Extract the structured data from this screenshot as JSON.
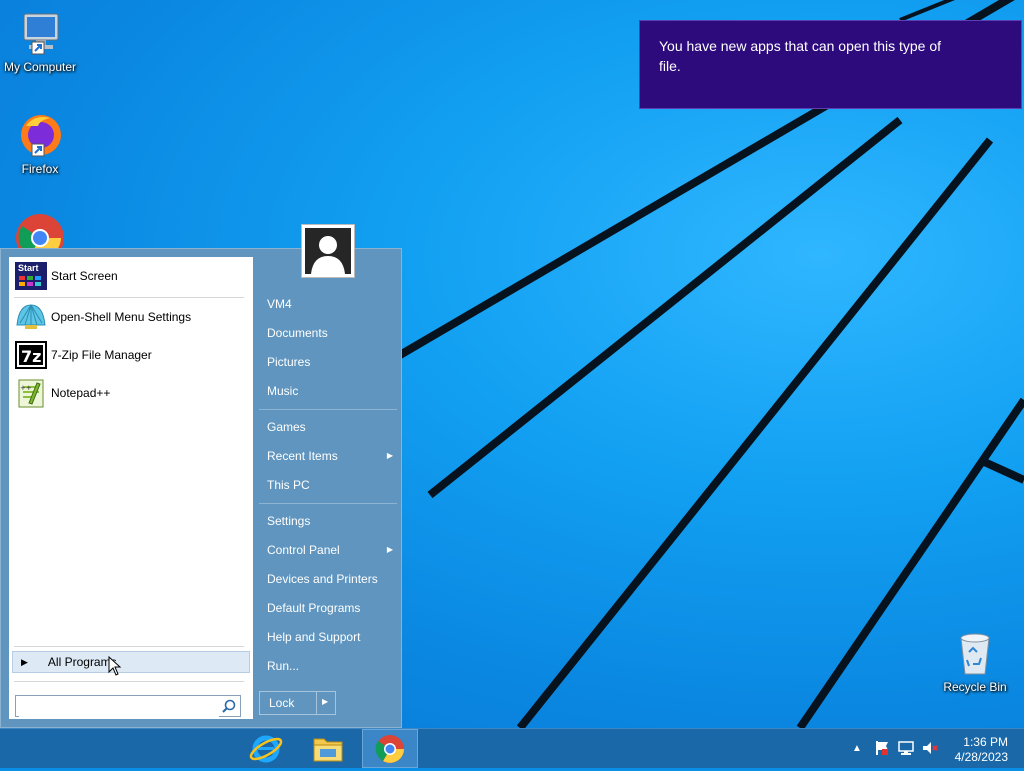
{
  "notification": {
    "text": "You have new apps that can open this type of file."
  },
  "desktop_icons": [
    {
      "label": "My Computer",
      "icon": "computer-icon"
    },
    {
      "label": "Firefox",
      "icon": "firefox-icon"
    },
    {
      "label": "",
      "icon": "chrome-icon"
    },
    {
      "label": "Recycle Bin",
      "icon": "recycle-bin-icon"
    }
  ],
  "start_menu": {
    "programs": [
      {
        "label": "Start Screen",
        "icon": "start-screen-icon"
      },
      {
        "label": "Open-Shell Menu Settings",
        "icon": "open-shell-icon"
      },
      {
        "label": "7-Zip File Manager",
        "icon": "7zip-icon"
      },
      {
        "label": "Notepad++",
        "icon": "notepadpp-icon"
      }
    ],
    "all_programs": "All Programs",
    "search_placeholder": "",
    "right_items": [
      {
        "label": "VM4"
      },
      {
        "label": "Documents"
      },
      {
        "label": "Pictures"
      },
      {
        "label": "Music"
      },
      {
        "label": "Games"
      },
      {
        "label": "Recent Items",
        "submenu": true
      },
      {
        "label": "This PC"
      },
      {
        "label": "Settings"
      },
      {
        "label": "Control Panel",
        "submenu": true
      },
      {
        "label": "Devices and Printers"
      },
      {
        "label": "Default Programs"
      },
      {
        "label": "Help and Support"
      },
      {
        "label": "Run..."
      }
    ],
    "lock_label": "Lock",
    "start_screen_tile_text": "Start"
  },
  "taskbar": {
    "pinned": [
      {
        "icon": "internet-explorer-icon"
      },
      {
        "icon": "file-explorer-icon"
      },
      {
        "icon": "chrome-icon",
        "active": true
      }
    ],
    "time": "1:36 PM",
    "date": "4/28/2023",
    "tray_icons": [
      "show-hidden-icon",
      "action-center-flag-icon",
      "network-icon",
      "volume-muted-icon"
    ]
  },
  "colors": {
    "desktop": "#0a8fe6",
    "toast": "#2d0b7d",
    "start_menu": "#5f95be",
    "taskbar": "#1a68a8"
  }
}
